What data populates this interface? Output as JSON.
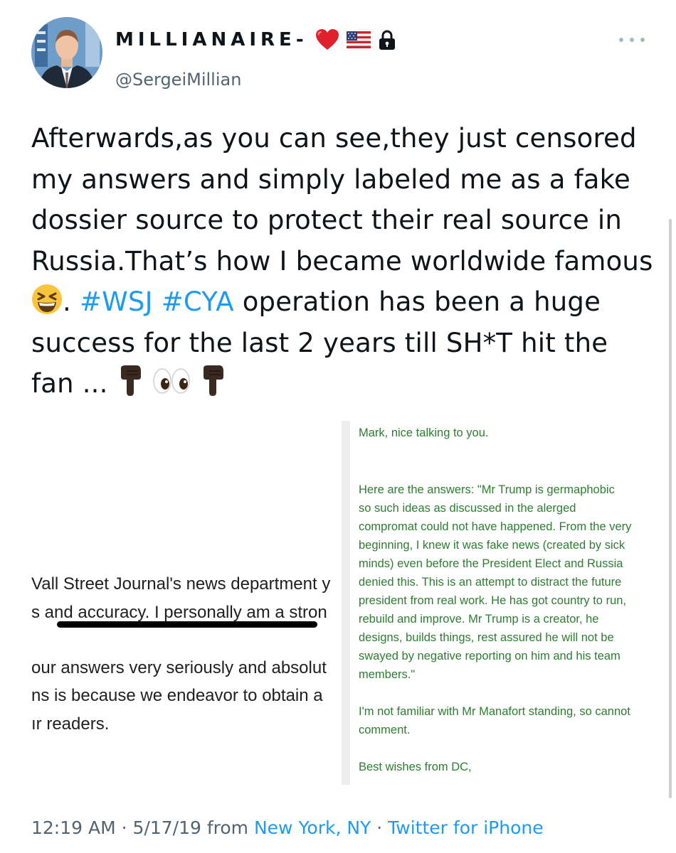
{
  "author": {
    "display_name": "MILLIANAIRE-",
    "handle": "@SergeiMillian",
    "badges": [
      "heart-emoji",
      "us-flag-emoji",
      "lock-icon"
    ]
  },
  "tweet": {
    "text_part1": "Afterwards,as you can see,they just censored my answers and simply labeled me as a fake dossier source to protect their real source in Russia.That’s how I became worldwide famous",
    "emoji_1": "grinning-squinting-face",
    "text_part2": ". ",
    "hashtag_1": "#WSJ",
    "hashtag_2": "#CYA",
    "text_part3": " operation has been a huge success for the last 2 years till SH*T hit the fan ... ",
    "trailing_emojis": [
      "pointing-down-hand",
      "eyes",
      "pointing-down-hand"
    ]
  },
  "media": {
    "left_lines": [
      "Vall Street Journal's news department y",
      "s and accuracy. I personally am a stron",
      "our answers very seriously and absolut",
      "ns is because we endeavor to obtain a",
      "ır readers."
    ],
    "right_lines": [
      "Mark, nice talking to you.",
      "Here are the answers: \"Mr Trump is germaphobic",
      "so such ideas as discussed in the alerged",
      "compromat could not have happened. From the very",
      "beginning, I knew it was fake news (created by sick",
      "minds) even before the President Elect and Russia",
      "denied this. This is an attempt to distract the future",
      "president from real work. He has got country to run,",
      "rebuild and improve. Mr Trump is a creator, he",
      "designs, builds things, rest assured he will not be",
      "swayed by negative reporting on him and his team",
      "members.\"",
      "I'm not familiar with Mr Manafort standing, so cannot",
      "comment.",
      "Best wishes from DC,"
    ]
  },
  "footer": {
    "time": "12:19 AM",
    "sep1": " · ",
    "date": "5/17/19",
    "from": " from ",
    "location": "New York, NY",
    "sep2": " · ",
    "source": "Twitter for iPhone"
  },
  "colors": {
    "link": "#1d9bf0",
    "secondary_text": "#536471",
    "email_text": "#2e7d32"
  }
}
